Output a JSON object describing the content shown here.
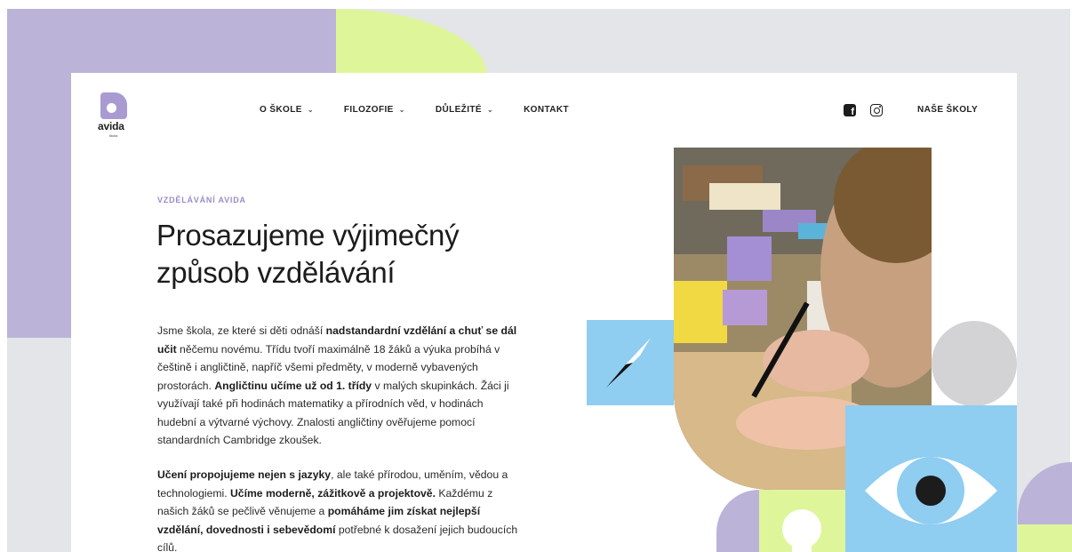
{
  "header": {
    "logo_text": "avida",
    "logo_sub": "škola",
    "nav": [
      {
        "label": "O ŠKOLE",
        "has_dropdown": true
      },
      {
        "label": "FILOZOFIE",
        "has_dropdown": true
      },
      {
        "label": "DŮLEŽITÉ",
        "has_dropdown": true
      },
      {
        "label": "KONTAKT",
        "has_dropdown": false
      }
    ],
    "chevron": "⌄",
    "social_icons": [
      "facebook-icon",
      "instagram-icon"
    ],
    "schools_link": "NAŠE ŠKOLY"
  },
  "hero": {
    "eyebrow": "VZDĚLÁVÁNÍ AVIDA",
    "headline": "Prosazujeme výjimečný způsob vzdělávání",
    "para1": [
      {
        "t": "Jsme škola, ze které si děti odnáší ",
        "b": false
      },
      {
        "t": "nadstandardní vzdělání a chuť se dál učit",
        "b": true
      },
      {
        "t": " něčemu novému. Třídu tvoří maximálně 18 žáků a výuka probíhá v češtině i angličtině, napříč všemi předměty, v moderně vybavených prostorách. ",
        "b": false
      },
      {
        "t": "Angličtinu učíme už od 1. třídy",
        "b": true
      },
      {
        "t": " v malých skupinkách. Žáci ji využívají také při hodinách matematiky a přírodních věd, v hodinách hudební a výtvarné výchovy. Znalosti angličtiny ověřujeme pomocí standardních Cambridge zkoušek.",
        "b": false
      }
    ],
    "para2": [
      {
        "t": "Učení propojujeme nejen s jazyky",
        "b": true
      },
      {
        "t": ", ale také přírodou, uměním, vědou a technologiemi. ",
        "b": false
      },
      {
        "t": "Učíme moderně, zážitkově a projektově.",
        "b": true
      },
      {
        "t": " Každému z našich žáků se pečlivě věnujeme a ",
        "b": false
      },
      {
        "t": "pomáháme jim získat nejlepší vzdělání, dovednosti i sebevědomí",
        "b": true
      },
      {
        "t": " potřebné k dosažení jejich budoucích cílů.",
        "b": false
      }
    ]
  },
  "colors": {
    "purple": "#bcb3d9",
    "lime": "#dff59a",
    "sky_blue": "#8fcdf1",
    "gray": "#e3e5e8",
    "accent_text": "#9a8cc9"
  },
  "graphics": {
    "photo": "child-writing-photo",
    "shapes": [
      "compass-icon",
      "eye-icon",
      "circle-shape",
      "keyhole-shape"
    ]
  }
}
